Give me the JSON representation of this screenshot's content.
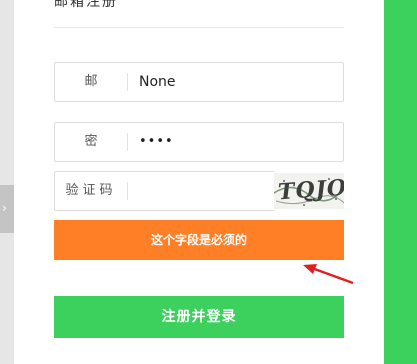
{
  "header": {
    "title": "邮箱注册"
  },
  "form": {
    "email": {
      "label": "邮  箱",
      "value": "None"
    },
    "password": {
      "label": "密  码",
      "value": "••••"
    },
    "captcha": {
      "label": "验证码",
      "value": "",
      "image_text": "TQJO"
    }
  },
  "error": {
    "message": "这个字段是必须的"
  },
  "submit": {
    "label": "注册并登录"
  },
  "colors": {
    "accent_green": "#3cd05c",
    "error_orange": "#ff7f27",
    "arrow_red": "#e02020"
  },
  "icons": {
    "side_tab": "chevron-right-icon",
    "annotation": "red-arrow-icon"
  }
}
